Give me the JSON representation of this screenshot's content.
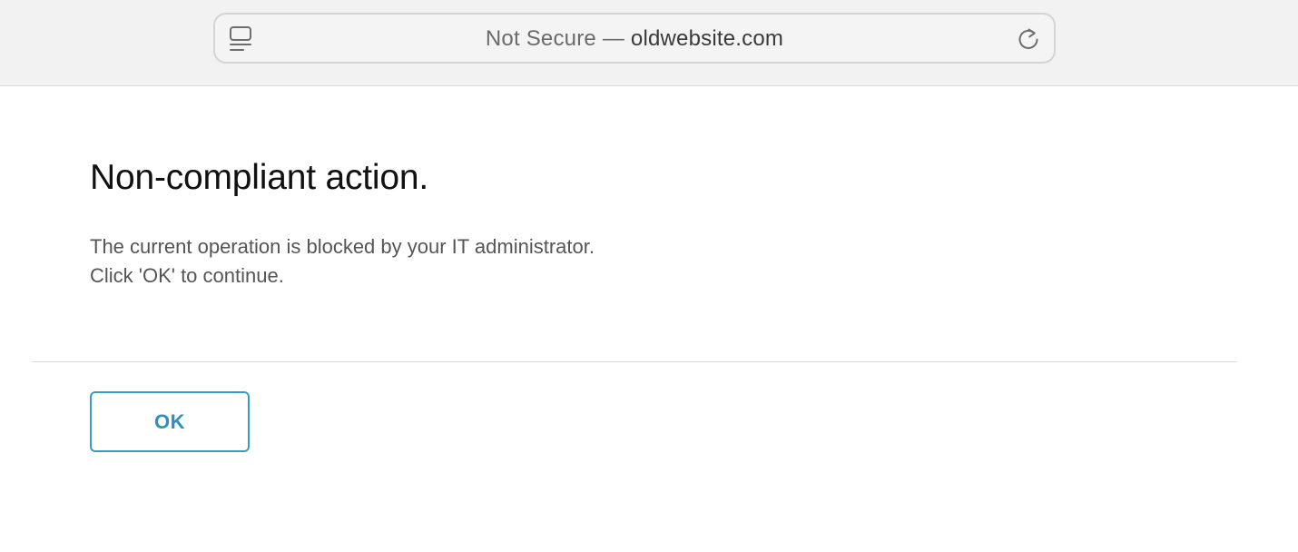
{
  "browser": {
    "address_bar": {
      "security_label": "Not Secure",
      "separator": "—",
      "domain": "oldwebsite.com",
      "left_icon": "reader-icon",
      "right_icon": "reload-icon"
    }
  },
  "dialog": {
    "title": "Non-compliant action.",
    "message_line1": "The current operation is blocked by your IT administrator.",
    "message_line2": "Click 'OK' to continue.",
    "ok_label": "OK",
    "accent_color": "#3a9cc5"
  }
}
